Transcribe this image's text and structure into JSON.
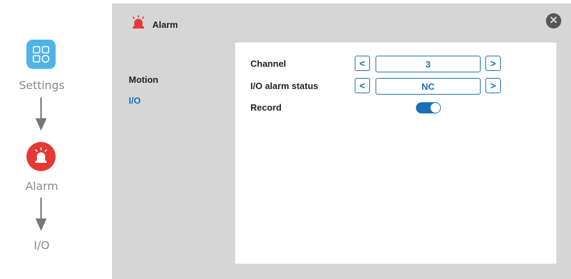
{
  "guide": {
    "steps": [
      {
        "label": "Settings",
        "icon": "settings-grid-icon"
      },
      {
        "label": "Alarm",
        "icon": "alarm-siren-icon"
      },
      {
        "label": "I/O"
      }
    ]
  },
  "dialog": {
    "title": "Alarm",
    "title_icon": "alarm-siren-icon",
    "close_icon": "close-icon",
    "menu": [
      {
        "label": "Motion",
        "active": false
      },
      {
        "label": "I/O",
        "active": true
      }
    ],
    "fields": {
      "channel": {
        "label": "Channel",
        "value": "3"
      },
      "io_status": {
        "label": "I/O alarm status",
        "value": "NC"
      },
      "record": {
        "label": "Record",
        "enabled": true
      }
    },
    "prev_glyph": "<",
    "next_glyph": ">"
  },
  "colors": {
    "accent": "#1a6fb5",
    "alarm_red": "#e53935",
    "settings_blue": "#4fb3e6",
    "panel_bg": "#d6d6d6"
  }
}
